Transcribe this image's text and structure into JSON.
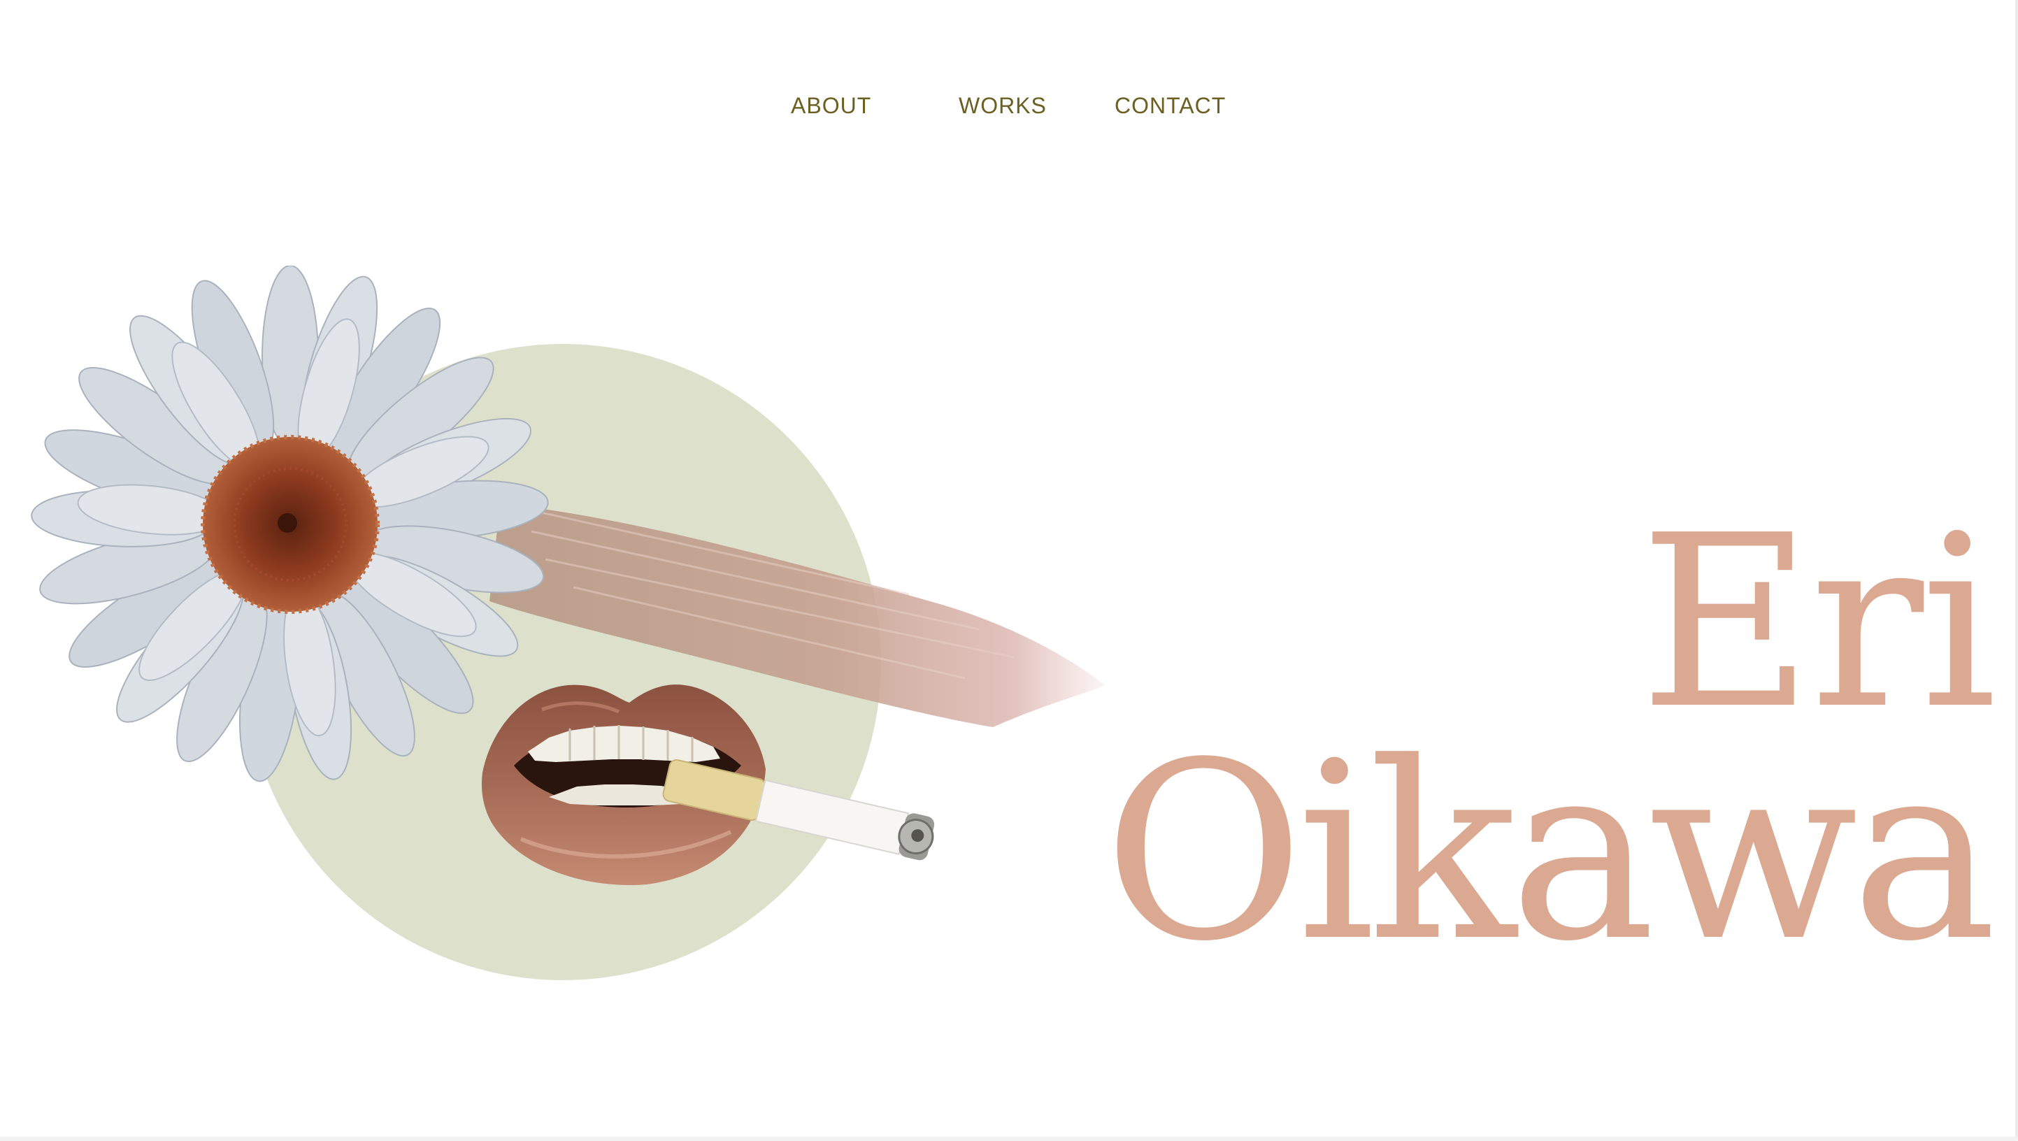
{
  "nav": {
    "items": [
      {
        "label": "ABOUT"
      },
      {
        "label": "WORKS"
      },
      {
        "label": "CONTACT"
      }
    ]
  },
  "hero": {
    "first_name": "Eri",
    "last_name": "Oikawa"
  },
  "colors": {
    "nav_text": "#6b5f22",
    "name_text": "#dba991",
    "circle": "#dde1cc",
    "brush": "#c7a291",
    "lips": "#a56a55",
    "daisy_petal": "#d4dae0",
    "daisy_center": "#8e3b1f"
  },
  "icons": {
    "collage": [
      "daisy-icon",
      "brush-stroke-icon",
      "lips-icon",
      "cigarette-icon"
    ]
  }
}
